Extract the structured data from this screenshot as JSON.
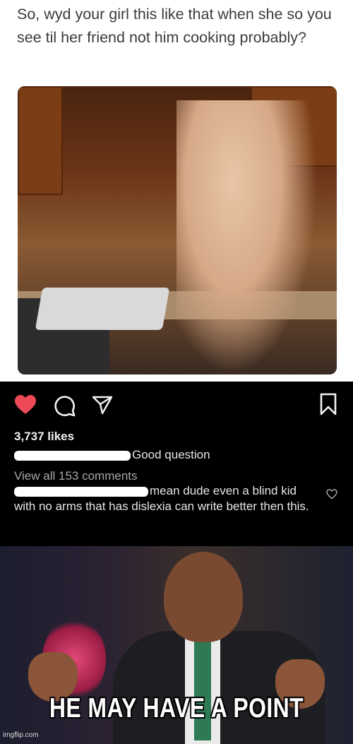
{
  "post": {
    "caption": "So, wyd your girl this like that when she so you see til her friend not him cooking probably?"
  },
  "instagram": {
    "likes": "3,737 likes",
    "comment1_text": "Good question",
    "view_all": "View all 153 comments",
    "comment2_text": "mean dude even a blind kid with no arms that has dislexia can write better then this.",
    "colors": {
      "heart": "#ed4956",
      "background": "#000000"
    },
    "icons": [
      "heart-icon",
      "comment-icon",
      "share-icon",
      "bookmark-icon",
      "small-heart-icon"
    ]
  },
  "meme": {
    "text": "HE MAY HAVE A POINT",
    "watermark": "imgflip.com"
  }
}
